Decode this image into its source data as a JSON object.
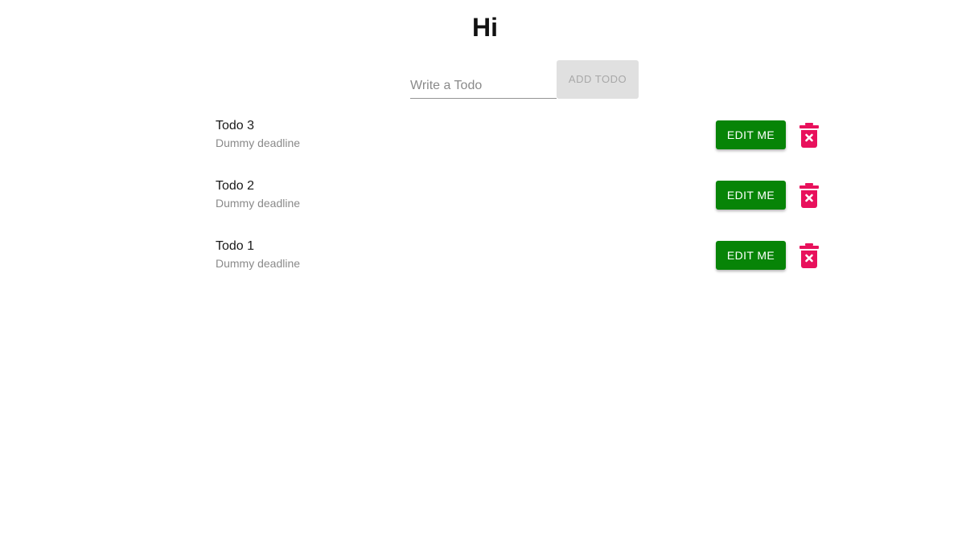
{
  "page": {
    "title": "Hi"
  },
  "form": {
    "input_placeholder": "Write a Todo",
    "input_value": "",
    "add_label": "ADD TODO"
  },
  "todos": [
    {
      "title": "Todo 3",
      "deadline": "Dummy deadline",
      "edit_label": "EDIT ME",
      "delete_icon": "trash-x-icon"
    },
    {
      "title": "Todo 2",
      "deadline": "Dummy deadline",
      "edit_label": "EDIT ME",
      "delete_icon": "trash-x-icon"
    },
    {
      "title": "Todo 1",
      "deadline": "Dummy deadline",
      "edit_label": "EDIT ME",
      "delete_icon": "trash-x-icon"
    }
  ],
  "colors": {
    "edit_button": "#078407",
    "delete_icon": "#e8115c",
    "add_button_disabled": "#e0e0e0"
  }
}
